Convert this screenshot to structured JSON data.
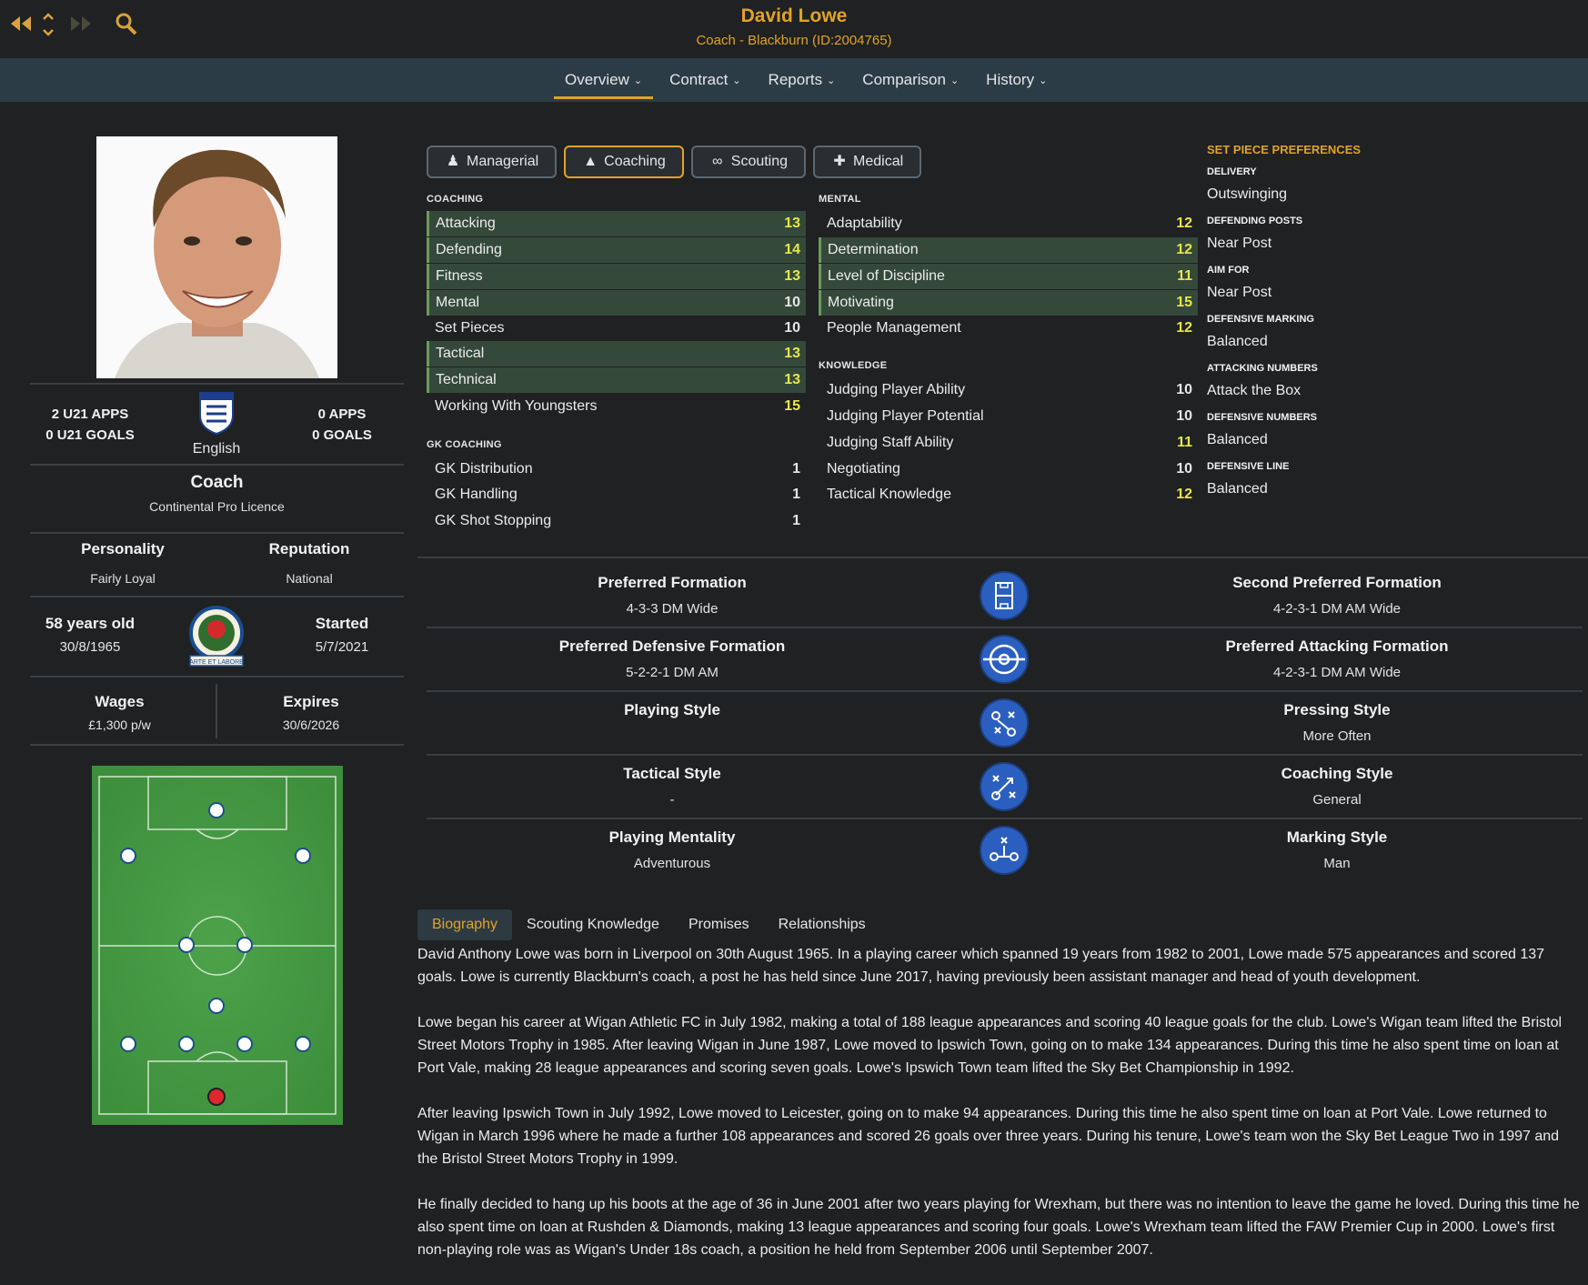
{
  "header": {
    "name": "David Lowe",
    "subtitle": "Coach - Blackburn (ID:2004765)",
    "nav_back_icon": "rewind-icon",
    "nav_forward_icon": "fast-forward-icon",
    "nav_updown_icon": "chevron-updown-icon",
    "search_icon": "search-icon"
  },
  "tabs": [
    {
      "label": "Overview"
    },
    {
      "label": "Contract"
    },
    {
      "label": "Reports"
    },
    {
      "label": "Comparison"
    },
    {
      "label": "History"
    }
  ],
  "profile": {
    "u21_apps": "2 U21 APPS",
    "u21_goals": "0 U21 GOALS",
    "apps": "0 APPS",
    "goals": "0 GOALS",
    "nationality": "English",
    "fa_badge_text": "The FA",
    "role": "Coach",
    "licence": "Continental Pro Licence",
    "personality_label": "Personality",
    "personality": "Fairly Loyal",
    "reputation_label": "Reputation",
    "reputation": "National",
    "age": "58 years old",
    "dob": "30/8/1965",
    "started_label": "Started",
    "started": "5/7/2021",
    "club_badge_text": "ARTE ET LABORE",
    "wages_label": "Wages",
    "wages": "£1,300 p/w",
    "expires_label": "Expires",
    "expires": "30/6/2026"
  },
  "subtabs": [
    {
      "label": "Managerial",
      "icon": "person-icon"
    },
    {
      "label": "Coaching",
      "icon": "coach-icon"
    },
    {
      "label": "Scouting",
      "icon": "binoculars-icon"
    },
    {
      "label": "Medical",
      "icon": "medical-kit-icon"
    }
  ],
  "coaching": {
    "heading": "COACHING",
    "items": [
      {
        "label": "Attacking",
        "value": "13"
      },
      {
        "label": "Defending",
        "value": "14"
      },
      {
        "label": "Fitness",
        "value": "13"
      },
      {
        "label": "Mental",
        "value": "10"
      },
      {
        "label": "Set Pieces",
        "value": "10"
      },
      {
        "label": "Tactical",
        "value": "13"
      },
      {
        "label": "Technical",
        "value": "13"
      },
      {
        "label": "Working With Youngsters",
        "value": "15"
      }
    ]
  },
  "gk_coaching": {
    "heading": "GK COACHING",
    "items": [
      {
        "label": "GK Distribution",
        "value": "1"
      },
      {
        "label": "GK Handling",
        "value": "1"
      },
      {
        "label": "GK Shot Stopping",
        "value": "1"
      }
    ]
  },
  "mental": {
    "heading": "MENTAL",
    "items": [
      {
        "label": "Adaptability",
        "value": "12"
      },
      {
        "label": "Determination",
        "value": "12"
      },
      {
        "label": "Level of Discipline",
        "value": "11"
      },
      {
        "label": "Motivating",
        "value": "15"
      },
      {
        "label": "People Management",
        "value": "12"
      }
    ]
  },
  "knowledge": {
    "heading": "KNOWLEDGE",
    "items": [
      {
        "label": "Judging Player Ability",
        "value": "10"
      },
      {
        "label": "Judging Player Potential",
        "value": "10"
      },
      {
        "label": "Judging Staff Ability",
        "value": "11"
      },
      {
        "label": "Negotiating",
        "value": "10"
      },
      {
        "label": "Tactical Knowledge",
        "value": "12"
      }
    ]
  },
  "set_pieces": {
    "heading": "SET PIECE PREFERENCES",
    "items": [
      {
        "label": "DELIVERY",
        "value": "Outswinging"
      },
      {
        "label": "DEFENDING POSTS",
        "value": "Near Post"
      },
      {
        "label": "AIM FOR",
        "value": "Near Post"
      },
      {
        "label": "DEFENSIVE MARKING",
        "value": "Balanced"
      },
      {
        "label": "ATTACKING NUMBERS",
        "value": "Attack the Box"
      },
      {
        "label": "DEFENSIVE NUMBERS",
        "value": "Balanced"
      },
      {
        "label": "DEFENSIVE LINE",
        "value": "Balanced"
      }
    ]
  },
  "formations": [
    {
      "left_label": "Preferred Formation",
      "left_value": "4-3-3 DM Wide",
      "icon": "formation-pitch-icon",
      "right_label": "Second Preferred Formation",
      "right_value": "4-2-3-1 DM AM Wide"
    },
    {
      "left_label": "Preferred Defensive Formation",
      "left_value": "5-2-2-1 DM AM",
      "icon": "target-icon",
      "right_label": "Preferred Attacking Formation",
      "right_value": "4-2-3-1 DM AM Wide"
    },
    {
      "left_label": "Playing Style",
      "left_value": "",
      "icon": "tactics-arrows-icon",
      "right_label": "Pressing Style",
      "right_value": "More Often"
    },
    {
      "left_label": "Tactical Style",
      "left_value": "-",
      "icon": "tactics-board-icon",
      "right_label": "Coaching Style",
      "right_value": "General"
    },
    {
      "left_label": "Playing Mentality",
      "left_value": "Adventurous",
      "icon": "mentality-icon",
      "right_label": "Marking Style",
      "right_value": "Man"
    }
  ],
  "bio_tabs": [
    {
      "label": "Biography"
    },
    {
      "label": "Scouting Knowledge"
    },
    {
      "label": "Promises"
    },
    {
      "label": "Relationships"
    }
  ],
  "bio": {
    "p1": "David Anthony Lowe was born in Liverpool on 30th August 1965. In a playing career which spanned 19 years from 1982 to 2001, Lowe made 575 appearances and scored 137 goals. Lowe is currently Blackburn's coach, a post he has held since June 2017, having previously been assistant manager and head of youth development.",
    "p2": "Lowe began his career at Wigan Athletic FC in July 1982, making a total of 188 league appearances and scoring 40 league goals for the club. Lowe's Wigan team lifted the Bristol Street Motors Trophy in 1985. After leaving Wigan in June 1987, Lowe moved to Ipswich Town, going on to make 134 appearances. During this time he also spent time on loan at Port Vale, making 28 league appearances and scoring seven goals. Lowe's Ipswich Town team lifted the Sky Bet Championship in 1992.",
    "p3": "After leaving Ipswich Town in July 1992, Lowe moved to Leicester, going on to make 94 appearances. During this time he also spent time on loan at Port Vale. Lowe returned to Wigan in March 1996 where he made a further 108 appearances and scored 26 goals over three years. During his tenure, Lowe's team won the Sky Bet League Two in 1997 and the Bristol Street Motors Trophy in 1999.",
    "p4": "He finally decided to hang up his boots at the age of 36 in June 2001 after two years playing for Wrexham, but there was no intention to leave the game he loved. During this time he also spent time on loan at Rushden & Diamonds, making 13 league appearances and scoring four goals. Lowe's Wrexham team lifted the FAW Premier Cup in 2000. Lowe's first non-playing role was as Wigan's Under 18s coach, a position he held from September 2006 until September 2007."
  }
}
